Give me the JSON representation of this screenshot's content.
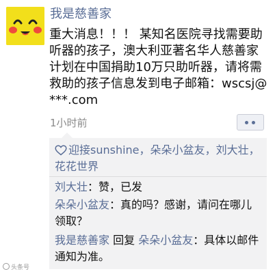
{
  "post": {
    "username": "我是慈善家",
    "text": "重大消息！！！ 某知名医院寻找需要助听器的孩子，澳大利亚著名华人慈善家计划在中国捐助10万只助听器，请将需救助的孩子信息发到电子邮箱：wscsj@***.com",
    "timestamp": "1小时前"
  },
  "likes": {
    "names": [
      "迎接sunshine",
      "朵朵小盆友",
      "刘大壮",
      "花花世界"
    ],
    "separator": "，"
  },
  "comments": [
    {
      "author": "刘大壮",
      "colon": "：",
      "text": "赞，已发"
    },
    {
      "author": "朵朵小盆友",
      "colon": "：",
      "text": "真的吗？感谢，请问在哪儿领取？"
    },
    {
      "author": "我是慈善家",
      "reply_word": "回复",
      "reply_to": "朵朵小盆友",
      "colon": "：",
      "text": "具体以邮件通知为准。"
    }
  ],
  "watermark": "头条号",
  "icons": {
    "avatar": "smiley-face-avatar",
    "more": "more-dots-icon",
    "like": "heart-outline-icon"
  },
  "colors": {
    "link": "#586c95",
    "avatar_bg": "#f2df1b",
    "comment_bg": "#f2f2f3"
  }
}
